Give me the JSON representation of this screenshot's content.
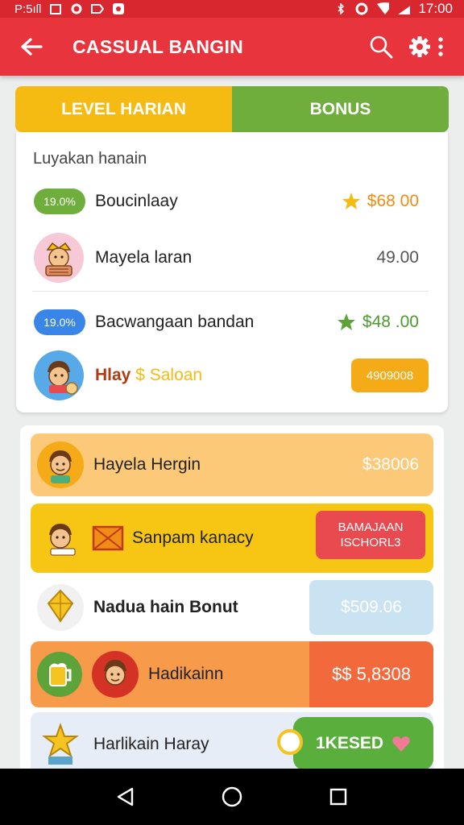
{
  "status_bar": {
    "left_text": "P:5ıſl",
    "time": "17:00"
  },
  "app_bar": {
    "title": "CASSUAL BANGIN"
  },
  "tabs": [
    {
      "label": "LEVEL HARIAN"
    },
    {
      "label": "BONUS"
    }
  ],
  "card1": {
    "heading": "Luyakan hanain",
    "rows": [
      {
        "badge": "19.0%",
        "label": "Boucinlaay",
        "amount": "$68  00"
      },
      {
        "label": "Mayela laran",
        "amount": "49.00"
      },
      {
        "badge": "19.0%",
        "label": "Bacwangaan bandan",
        "amount": "$48 .00"
      },
      {
        "label_main": "Hlay",
        "label_accent": "$ Saloan",
        "badge_right": "4909008"
      }
    ]
  },
  "card2": {
    "items": [
      {
        "label": "Hayela Hergin",
        "value": "$38006"
      },
      {
        "label": "Sanpam kanacy",
        "button_line1": "BAMAJAAN",
        "button_line2": "ISCHORL3"
      },
      {
        "label": "Nadua hain Bonut",
        "value": "$509.06"
      },
      {
        "label": "Hadikainn",
        "value": "$$ 5,8308"
      },
      {
        "label": "Harlikain Haray",
        "button": "1KESED"
      }
    ]
  },
  "colors": {
    "status": "#d8272f",
    "app_bar": "#e8343d",
    "tab_level": "#f6bb12",
    "tab_bonus": "#6fae3d",
    "green": "#6fae3d",
    "blue": "#3a86e8",
    "orange": "#f5aa17",
    "red_button": "#e84a4f"
  },
  "icons": {
    "back": "arrow-left-icon",
    "search": "search-icon",
    "settings": "gear-icon",
    "more": "more-vertical-icon",
    "star": "star-icon",
    "nav": [
      "back-triangle-icon",
      "home-circle-icon",
      "recents-square-icon"
    ]
  }
}
